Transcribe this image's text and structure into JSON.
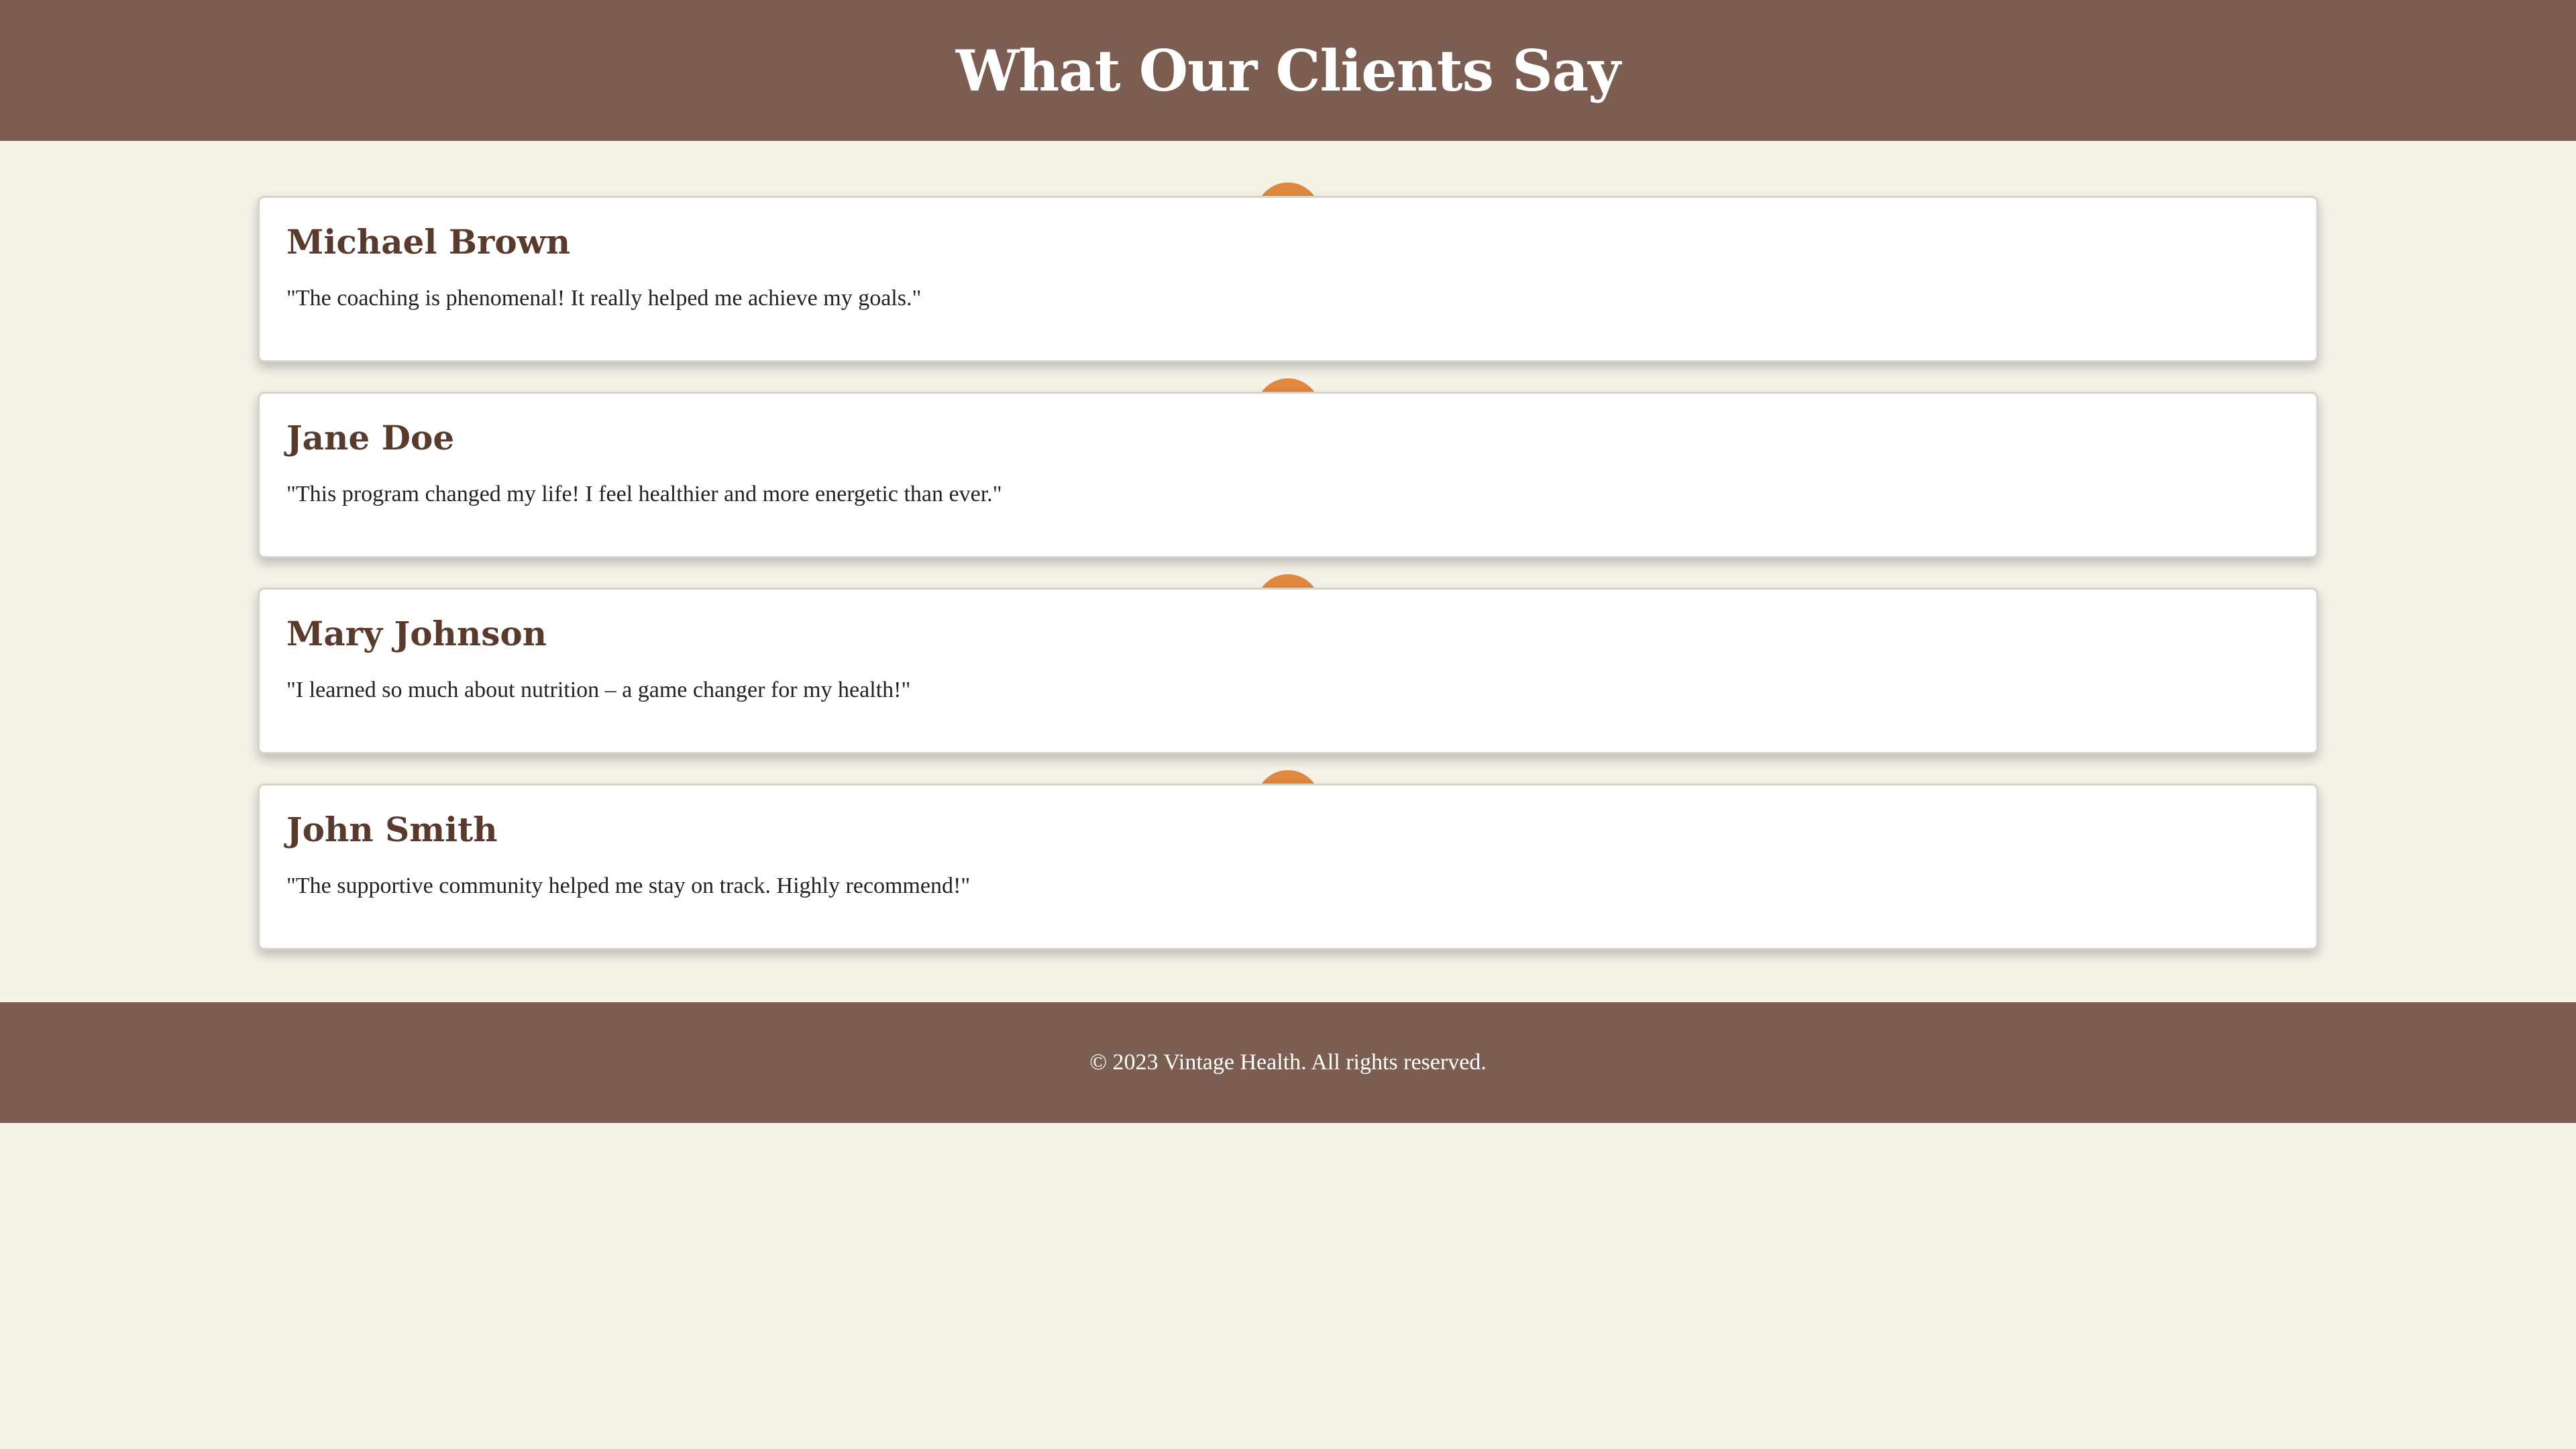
{
  "header": {
    "title": "What Our Clients Say"
  },
  "testimonials": [
    {
      "name": "Michael Brown",
      "quote": "\"The coaching is phenomenal! It really helped me achieve my goals.\""
    },
    {
      "name": "Jane Doe",
      "quote": "\"This program changed my life! I feel healthier and more energetic than ever.\""
    },
    {
      "name": "Mary Johnson",
      "quote": "\"I learned so much about nutrition – a game changer for my health!\""
    },
    {
      "name": "John Smith",
      "quote": "\"The supportive community helped me stay on track. Highly recommend!\""
    }
  ],
  "footer": {
    "text": "© 2023 Vintage Health. All rights reserved."
  },
  "colors": {
    "header_bg": "#7b5e51",
    "page_bg": "#f4f1e6",
    "accent_dot": "#e0883e",
    "name_text": "#5a3a2c"
  }
}
